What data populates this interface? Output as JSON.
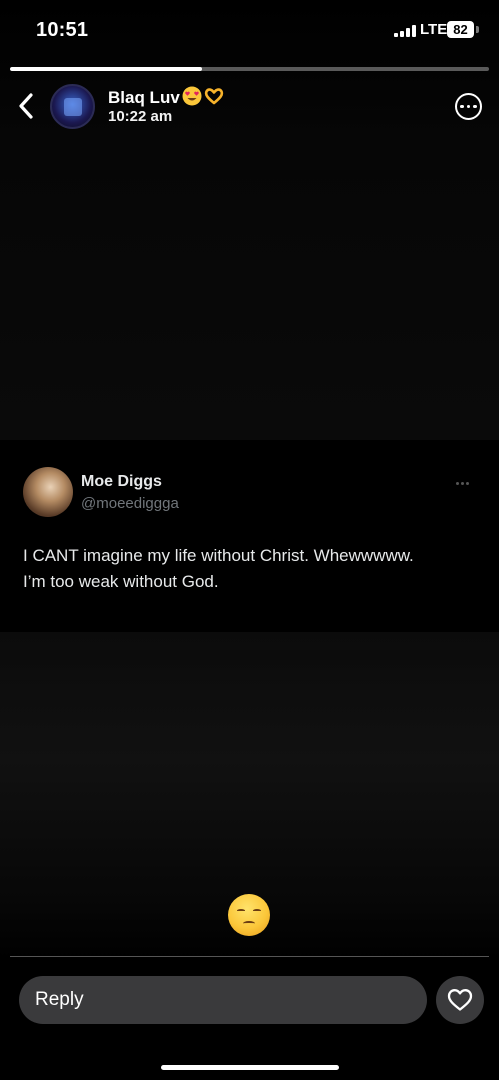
{
  "status_bar": {
    "time": "10:51",
    "network": "LTE",
    "battery": "82"
  },
  "story": {
    "progress": 0.4,
    "author_name": "Blaq Luv",
    "author_emojis": [
      "heart-eyes-emoji",
      "heart-hands-emoji"
    ],
    "posted_time": "10:22 am"
  },
  "tweet": {
    "display_name": "Moe Diggs",
    "handle": "@moeediggga",
    "text_line1": "I CANT imagine my life without Christ. Whewwwww.",
    "text_line2": "I’m too weak without God."
  },
  "reaction": {
    "emoji": "pensive-face-emoji"
  },
  "reply_bar": {
    "placeholder": "Reply"
  },
  "icons": {
    "back": "chevron-left-icon",
    "more": "ellipsis-circle-icon",
    "like": "heart-icon"
  }
}
